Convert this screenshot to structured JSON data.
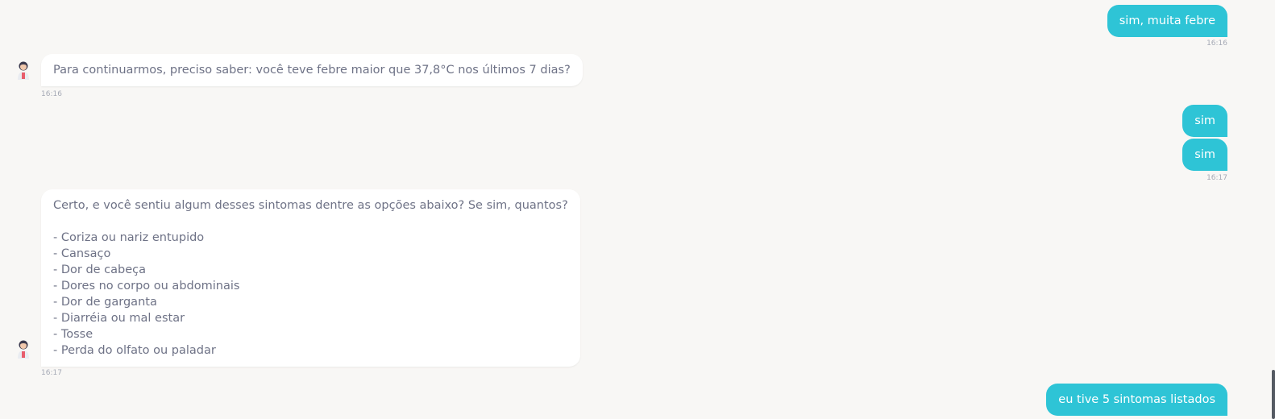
{
  "colors": {
    "background": "#f8f7f5",
    "user_bubble": "#2ec4d6",
    "bot_bubble": "#ffffff",
    "bot_text": "#6e7286",
    "timestamp": "#a5a9b5"
  },
  "messages": [
    {
      "sender": "user",
      "text": "sim, muita febre",
      "time": "16:16"
    },
    {
      "sender": "bot",
      "avatar_icon": "assistant-avatar-icon",
      "text": "Para continuarmos, preciso saber: você teve febre maior que 37,8°C nos últimos 7 dias?",
      "time": "16:16"
    },
    {
      "sender": "user",
      "text": "sim"
    },
    {
      "sender": "user",
      "text": "sim",
      "time": "16:17"
    },
    {
      "sender": "bot",
      "avatar_icon": "assistant-avatar-icon",
      "text": "Certo, e você sentiu algum desses sintomas dentre as opções abaixo? Se sim, quantos?\n\n- Coriza ou nariz entupido\n- Cansaço\n- Dor de cabeça\n- Dores no corpo ou abdominais\n- Dor de garganta\n- Diarréia ou mal estar\n- Tosse\n- Perda do olfato ou paladar",
      "time": "16:17"
    },
    {
      "sender": "user",
      "text": "eu tive 5 sintomas listados"
    }
  ]
}
